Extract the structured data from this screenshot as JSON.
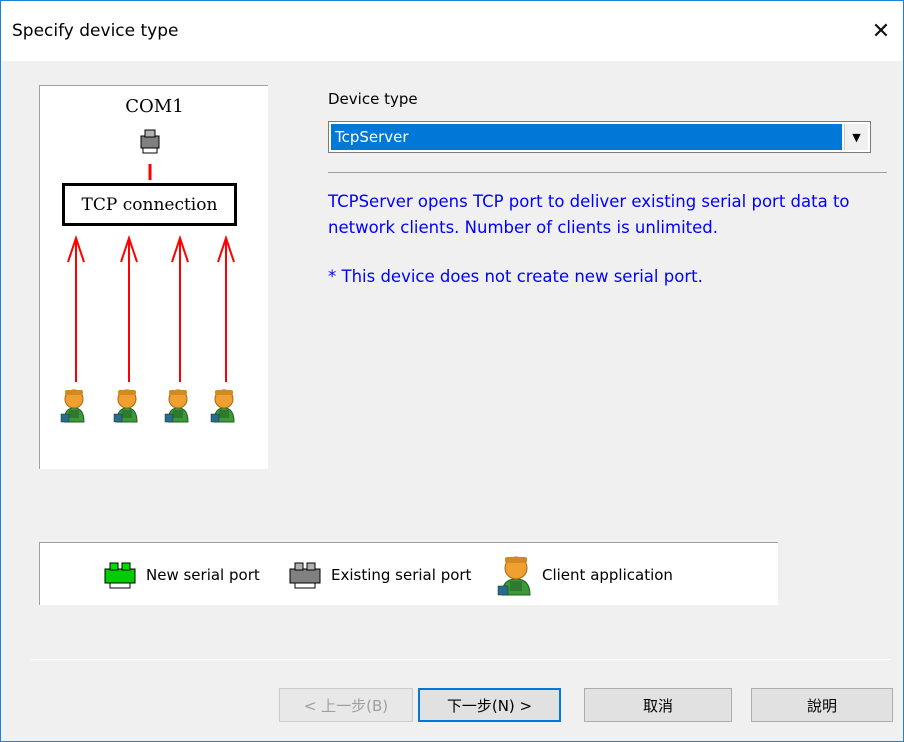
{
  "window": {
    "title": "Specify device type",
    "close_glyph": "✕"
  },
  "diagram": {
    "com_label": "COM1",
    "tcp_label": "TCP connection",
    "clients": 4
  },
  "device_type": {
    "label": "Device type",
    "selected": "TcpServer",
    "dropdown_glyph": "▼"
  },
  "description": {
    "text": "TCPServer opens TCP port to deliver existing serial port data to network clients. Number of clients is unlimited.",
    "note": "* This device does not create new serial port."
  },
  "legend": {
    "new_serial_port": "New serial port",
    "existing_serial_port": "Existing serial port",
    "client_application": "Client application"
  },
  "buttons": {
    "back": "< 上一步(B)",
    "next": "下一步(N) >",
    "cancel": "取消",
    "help": "說明"
  },
  "colors": {
    "selection": "#0078d7",
    "description_text": "#0000ff",
    "arrow": "#ff0000",
    "new_port": "#00cc00",
    "existing_port": "#808080"
  }
}
